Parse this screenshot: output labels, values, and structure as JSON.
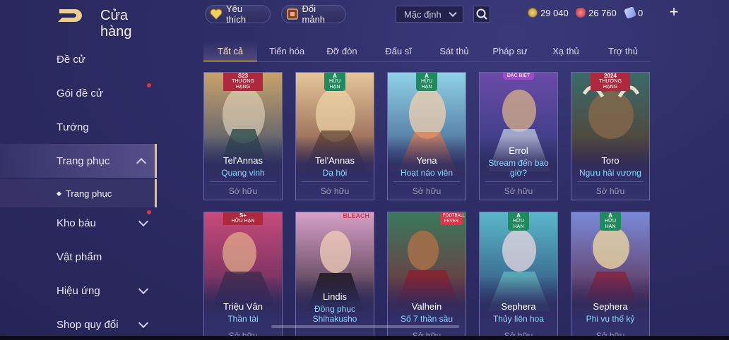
{
  "header": {
    "title": "Cửa hàng",
    "favorites_label": "Yêu thích",
    "exchange_label": "Đổi mảnh",
    "sort": {
      "selected": "Mặc định"
    },
    "currencies": [
      {
        "icon": "gold-coin-icon",
        "value": "29 040"
      },
      {
        "icon": "red-gem-icon",
        "value": "26 760"
      },
      {
        "icon": "voucher-icon",
        "value": "0"
      }
    ]
  },
  "sidebar": {
    "items": [
      {
        "label": "Đề cử"
      },
      {
        "label": "Gói đề cử",
        "notify": true
      },
      {
        "label": "Tướng"
      },
      {
        "label": "Trang phục",
        "active": true,
        "expanded": true
      },
      {
        "label": "Kho báu",
        "notify": true
      },
      {
        "label": "Vật phẩm"
      },
      {
        "label": "Hiệu ứng"
      },
      {
        "label": "Shop quy đổi"
      }
    ],
    "subitem": "Trang phục"
  },
  "tabs": [
    {
      "label": "Tất cả",
      "active": true
    },
    {
      "label": "Tiến hóa"
    },
    {
      "label": "Đỡ đòn"
    },
    {
      "label": "Đấu sĩ"
    },
    {
      "label": "Pháp sư"
    },
    {
      "label": "Sát thủ"
    },
    {
      "label": "Xạ thủ"
    },
    {
      "label": "Trợ thủ"
    }
  ],
  "cards": [
    {
      "hero": "Tel'Annas",
      "skin": "Quang vinh",
      "status": "Sở hữu",
      "badge_top": "S23",
      "badge_text": "THƯỜNG HẠNG"
    },
    {
      "hero": "Tel'Annas",
      "skin": "Dạ hội",
      "status": "Sở hữu",
      "badge_top": "A",
      "badge_text": "HỮU HẠN"
    },
    {
      "hero": "Yena",
      "skin": "Hoạt náo viên",
      "status": "Sở hữu",
      "badge_top": "A",
      "badge_text": "HỮU HẠN"
    },
    {
      "hero": "Errol",
      "skin": "Stream đến bao giờ?",
      "status": "Sở hữu",
      "badge_top": "",
      "badge_text": "ĐẶC BIỆT"
    },
    {
      "hero": "Toro",
      "skin": "Ngưu hải vương",
      "status": "Sở hữu",
      "badge_top": "2024",
      "badge_text": "THƯỜNG HẠNG"
    },
    {
      "hero": "Triệu Vân",
      "skin": "Thần tài",
      "status": "Sở hữu",
      "badge_top": "S+",
      "badge_text": "HỮU HẠN"
    },
    {
      "hero": "Lindis",
      "skin": "Đồng phục Shihakusho",
      "status": "",
      "badge_top": "BLEACH",
      "badge_text": ""
    },
    {
      "hero": "Valhein",
      "skin": "Số 7 thần sầu",
      "status": "Sở hữu",
      "badge_top": "FOOTBALL",
      "badge_text": "FEVER"
    },
    {
      "hero": "Sephera",
      "skin": "Thủy liên hoa",
      "status": "Sở hữu",
      "badge_top": "A",
      "badge_text": "HỮU HẠN"
    },
    {
      "hero": "Sephera",
      "skin": "Phi vụ thế kỷ",
      "status": "Sở hữu",
      "badge_top": "A",
      "badge_text": "HỮU HẠN"
    }
  ]
}
